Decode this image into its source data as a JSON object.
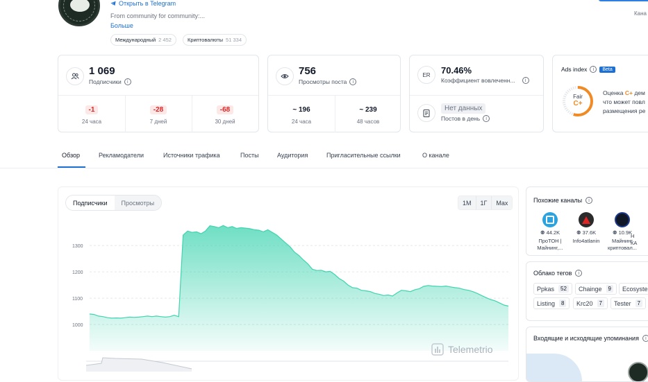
{
  "header": {
    "telegram_link": "Открыть в Telegram",
    "description": "From community for community:...",
    "more": "Больше",
    "tags": [
      {
        "label": "Международный",
        "count": "2 452"
      },
      {
        "label": "Криптовалюты",
        "count": "51 334"
      }
    ],
    "top_right_text": "Кана"
  },
  "stats": {
    "subscribers": {
      "value": "1 069",
      "label": "Подписчики",
      "periods": [
        {
          "value": "-1",
          "label": "24 часа"
        },
        {
          "value": "-28",
          "label": "7 дней"
        },
        {
          "value": "-68",
          "label": "30 дней"
        }
      ]
    },
    "views": {
      "value": "756",
      "label": "Просмотры поста",
      "periods": [
        {
          "value": "~ 196",
          "label": "24 часа"
        },
        {
          "value": "~ 239",
          "label": "48 часов"
        }
      ]
    },
    "er": {
      "icon_text": "ER",
      "value": "70.46%",
      "label": "Коэффициент вовлеченн...",
      "posts_value": "Нет данных",
      "posts_label": "Постов в день"
    },
    "ads": {
      "title": "Ads index",
      "badge": "Beta",
      "grade_word": "Fair",
      "grade": "C+",
      "text_line1_prefix": "Оценка",
      "text_line1_grade": "C+",
      "text_line1_suffix": "дем",
      "text_line2": "что может повл",
      "text_line3": "размещения ре"
    }
  },
  "tabs": [
    "Обзор",
    "Рекламодатели",
    "Источники трафика",
    "Посты",
    "Аудитория",
    "Пригласительные ссылки",
    "О канале"
  ],
  "chart": {
    "toggle": {
      "active": "Подписчики",
      "inactive": "Просмотры"
    },
    "ranges": [
      "1М",
      "1Г",
      "Max"
    ],
    "watermark": "Telemetrio",
    "accent": "#3fd4b0"
  },
  "chart_data": {
    "type": "area",
    "yticks": [
      1000,
      1100,
      1200,
      1300
    ],
    "ylim": [
      900,
      1390
    ],
    "series": [
      {
        "values": [
          1040,
          1038,
          1032,
          1030,
          1026,
          1024,
          1025,
          1024,
          1026,
          1028,
          1027,
          1028,
          1030,
          1032,
          1030,
          1032,
          1030,
          1028,
          1030,
          1035,
          1030,
          1340,
          1355,
          1350,
          1352,
          1345,
          1355,
          1375,
          1372,
          1368,
          1376,
          1368,
          1372,
          1365,
          1368,
          1366,
          1364,
          1360,
          1358,
          1352,
          1360,
          1350,
          1340,
          1325,
          1310,
          1295,
          1275,
          1262,
          1245,
          1230,
          1210,
          1205,
          1206,
          1200,
          1202,
          1190,
          1175,
          1165,
          1150,
          1140,
          1138,
          1130,
          1128,
          1125,
          1118,
          1115,
          1110,
          1112,
          1108,
          1120,
          1130,
          1128,
          1125,
          1132,
          1136,
          1145,
          1148,
          1146,
          1145,
          1144,
          1146,
          1143,
          1140,
          1138,
          1133,
          1130,
          1125,
          1118,
          1110,
          1102,
          1095,
          1090,
          1082,
          1074,
          1070
        ]
      }
    ]
  },
  "sidebar": {
    "similar_title": "Похожие каналы",
    "channels": [
      {
        "count": "44.2K",
        "name": "ПроТОН | Майнинг,..."
      },
      {
        "count": "37.6K",
        "name": "Info4atlanin"
      },
      {
        "count": "10.9K",
        "name": "Майнинг криптовал..."
      },
      {
        "count": "",
        "name": "Н КА"
      }
    ],
    "tags_title": "Облако тегов",
    "tag_cloud": [
      {
        "label": "Ppkas",
        "count": "52"
      },
      {
        "label": "Chainge",
        "count": "9"
      },
      {
        "label": "Ecosyste",
        "count": ""
      },
      {
        "label": "Listing",
        "count": "8"
      },
      {
        "label": "Krc20",
        "count": "7"
      },
      {
        "label": "Tester",
        "count": "7"
      }
    ],
    "mentions_title": "Входящие и исходящие упоминания"
  }
}
